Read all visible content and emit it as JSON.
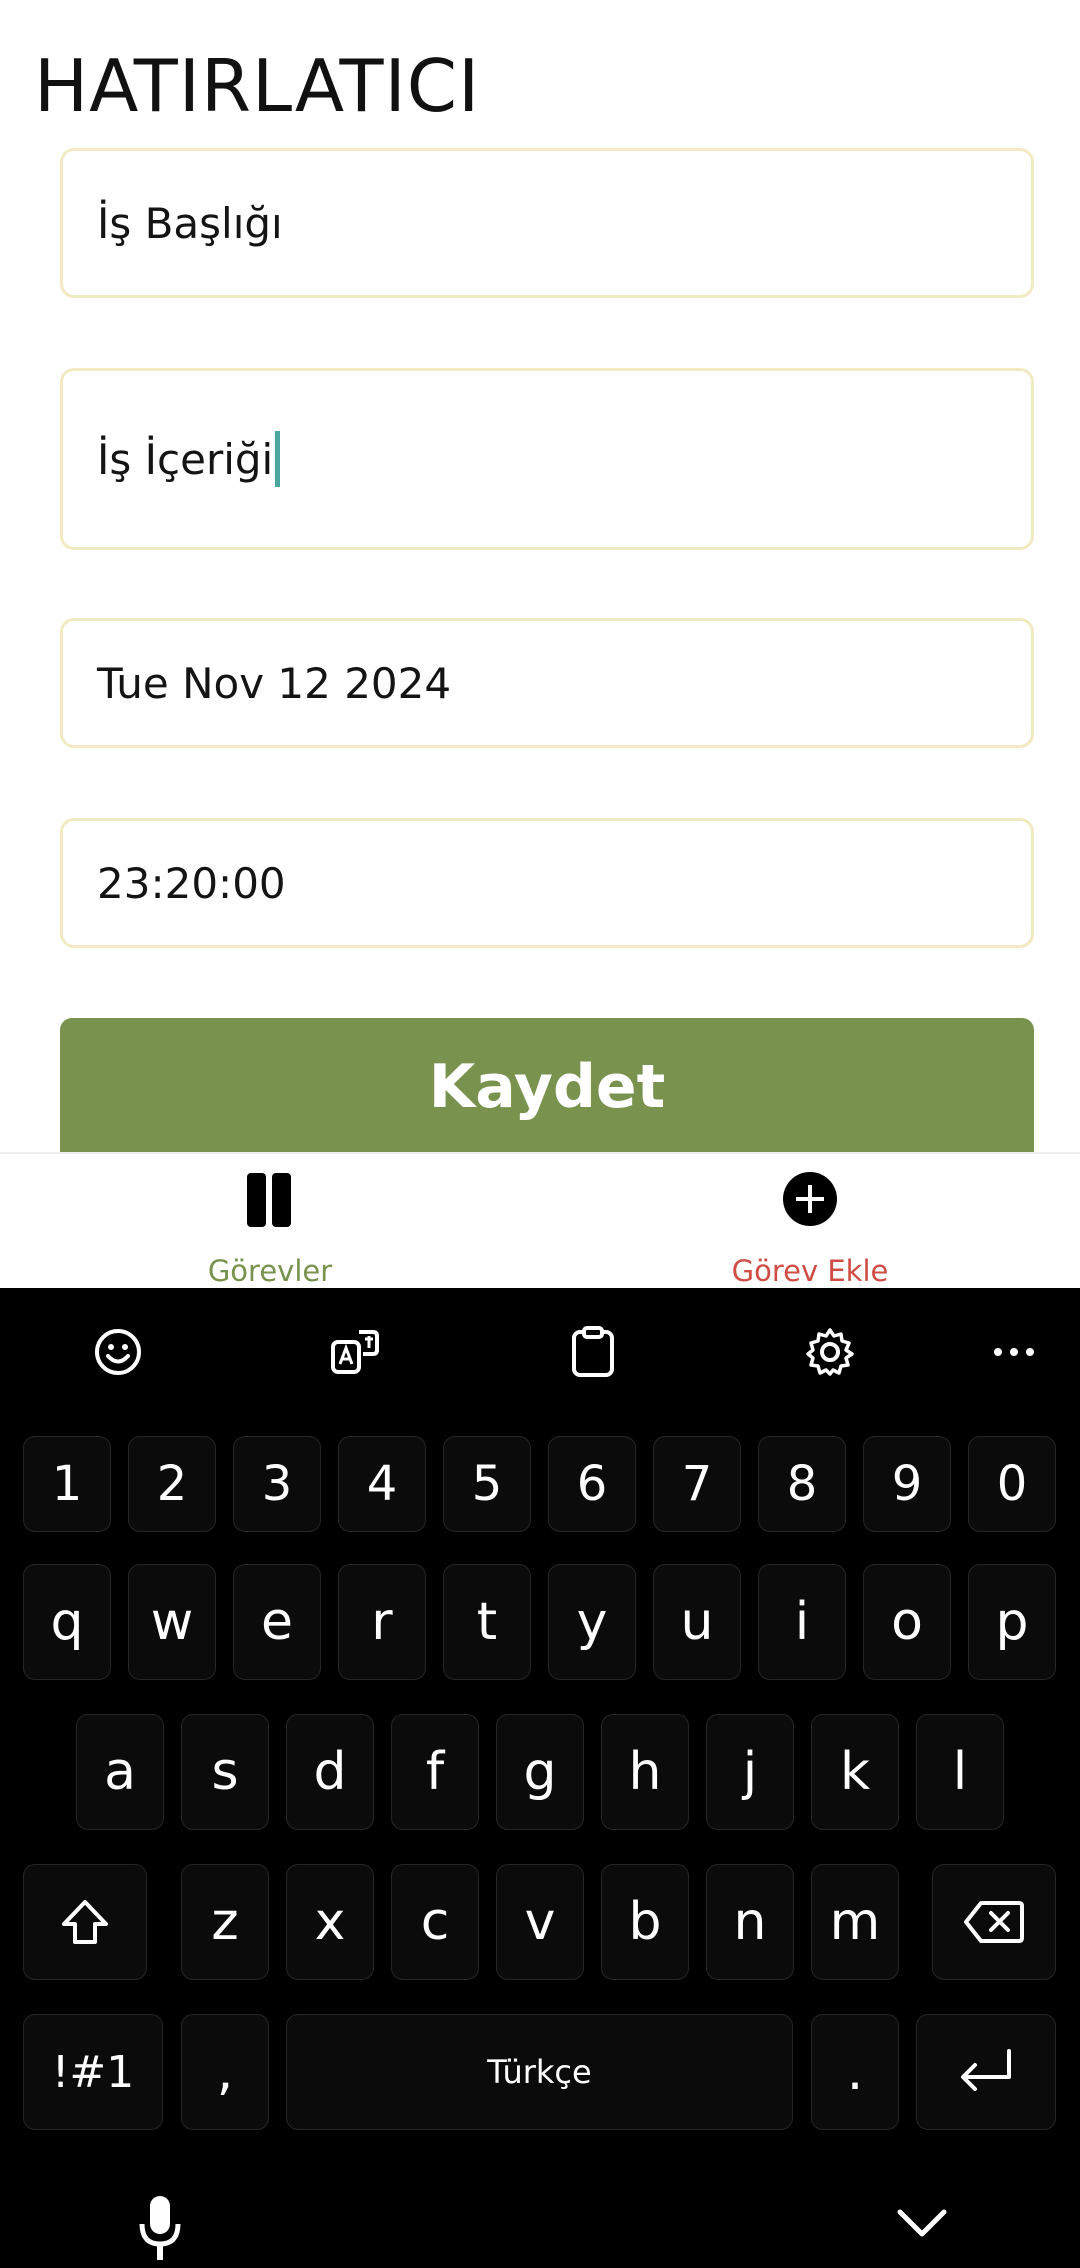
{
  "app": {
    "title": "HATIRLATICI",
    "form": {
      "title_field": "İş Başlığı",
      "content_field": "İş İçeriği",
      "date_field": "Tue Nov 12 2024",
      "time_field": "23:20:00",
      "save_label": "Kaydet"
    },
    "tabs": [
      {
        "label": "Görevler",
        "icon": "book-icon",
        "color": "#79924e"
      },
      {
        "label": "Görev Ekle",
        "icon": "plus-circle-icon",
        "color": "#cf4d45"
      }
    ]
  },
  "keyboard": {
    "toolbar": [
      "emoji-icon",
      "translate-icon",
      "clipboard-icon",
      "settings-icon",
      "more-icon"
    ],
    "number_row": [
      "1",
      "2",
      "3",
      "4",
      "5",
      "6",
      "7",
      "8",
      "9",
      "0"
    ],
    "row1": [
      "q",
      "w",
      "e",
      "r",
      "t",
      "y",
      "u",
      "i",
      "o",
      "p"
    ],
    "row2": [
      "a",
      "s",
      "d",
      "f",
      "g",
      "h",
      "j",
      "k",
      "l"
    ],
    "row3": [
      "z",
      "x",
      "c",
      "v",
      "b",
      "n",
      "m"
    ],
    "symbols_key": "!#1",
    "comma_key": ",",
    "space_label": "Türkçe",
    "period_key": ".",
    "bottom_icons": [
      "microphone-icon",
      "chevron-down-icon"
    ]
  },
  "colors": {
    "accent_green": "#79924e",
    "accent_red": "#cf4d45",
    "field_border": "#f1eac2",
    "keyboard_bg": "#000000"
  }
}
